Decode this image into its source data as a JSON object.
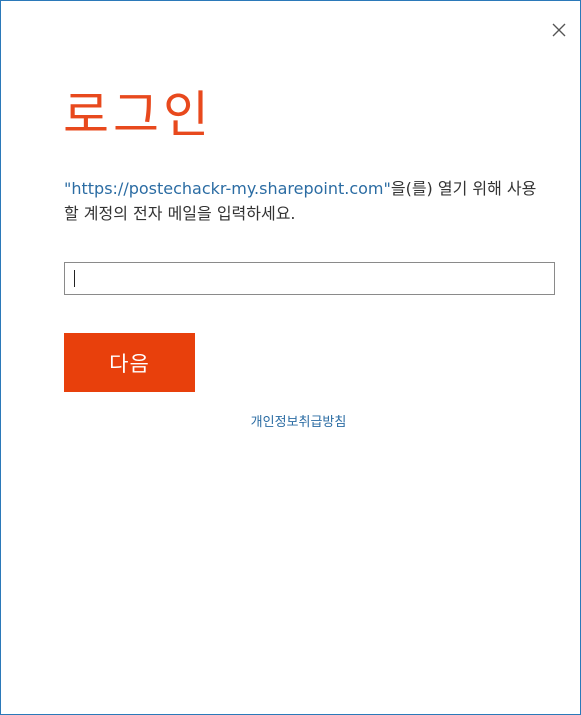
{
  "dialog": {
    "title": "로그인",
    "description_quote_open": "\"",
    "description_url": "https://postechackr-my.sharepoint.com",
    "description_quote_close": "\"",
    "description_rest": "을(를) 열기 위해 사용할 계정의 전자 메일을 입력하세요.",
    "email_value": "",
    "next_button_label": "다음",
    "privacy_link_label": "개인정보취급방침",
    "close_icon": "close-icon"
  },
  "colors": {
    "accent": "#e8400c",
    "title": "#e8491d",
    "link": "#2b6ca3",
    "border": "#2b79b9"
  }
}
